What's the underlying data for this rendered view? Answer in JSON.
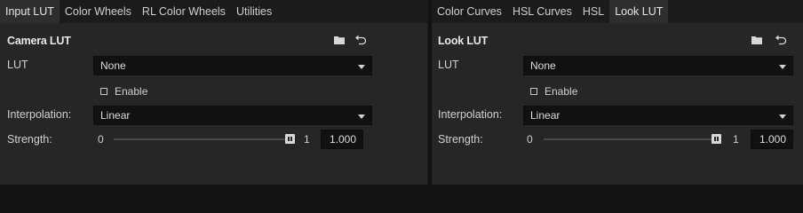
{
  "tabs_left": [
    {
      "label": "Input LUT",
      "active": true
    },
    {
      "label": "Color Wheels",
      "active": false
    },
    {
      "label": "RL Color Wheels",
      "active": false
    },
    {
      "label": "Utilities",
      "active": false
    }
  ],
  "tabs_right": [
    {
      "label": "Color Curves",
      "active": false
    },
    {
      "label": "HSL Curves",
      "active": false
    },
    {
      "label": "HSL",
      "active": false
    },
    {
      "label": "Look LUT",
      "active": true
    }
  ],
  "left_panel": {
    "title": "Camera LUT",
    "lut_label": "LUT",
    "lut_value": "None",
    "enable_label": "Enable",
    "enable_checked": false,
    "interp_label": "Interpolation:",
    "interp_value": "Linear",
    "strength_label": "Strength:",
    "strength_min": "0",
    "strength_max": "1",
    "strength_value": "1.000",
    "strength_fraction": 1.0
  },
  "right_panel": {
    "title": "Look LUT",
    "lut_label": "LUT",
    "lut_value": "None",
    "enable_label": "Enable",
    "enable_checked": false,
    "interp_label": "Interpolation:",
    "interp_value": "Linear",
    "strength_label": "Strength:",
    "strength_min": "0",
    "strength_max": "1",
    "strength_value": "1.000",
    "strength_fraction": 1.0
  },
  "icons": {
    "folder": "folder-icon",
    "reset": "reset-icon"
  },
  "colors": {
    "background": "#141414",
    "panel": "#262626",
    "active_tab": "#2e2e2e",
    "field": "#111111",
    "text": "#d4d4d4"
  }
}
